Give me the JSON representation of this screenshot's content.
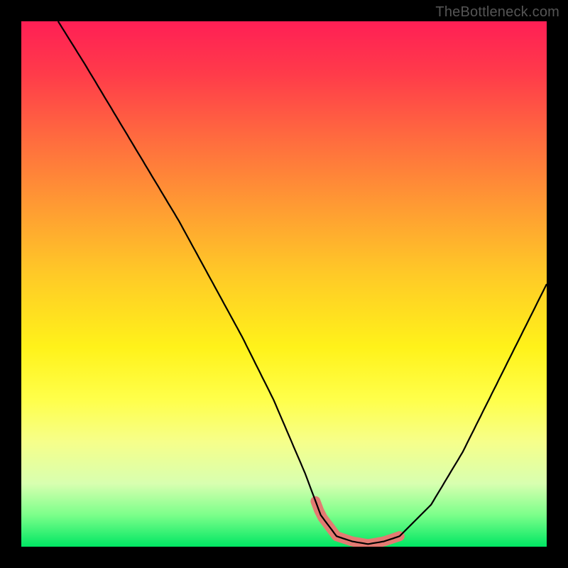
{
  "watermark": "TheBottleneck.com",
  "chart_data": {
    "type": "line",
    "title": "",
    "xlabel": "",
    "ylabel": "",
    "xlim": [
      0,
      100
    ],
    "ylim": [
      0,
      100
    ],
    "grid": false,
    "legend": false,
    "series": [
      {
        "name": "bottleneck-curve",
        "x": [
          7,
          12,
          18,
          24,
          30,
          36,
          42,
          48,
          54,
          57,
          60,
          63,
          66,
          69,
          72,
          78,
          84,
          90,
          96,
          100
        ],
        "y": [
          100,
          92,
          82,
          72,
          62,
          51,
          40,
          28,
          14,
          6,
          2,
          1,
          0.5,
          1,
          2,
          8,
          18,
          30,
          42,
          50
        ]
      }
    ],
    "highlight": {
      "name": "optimal-zone",
      "x_range": [
        56,
        72
      ],
      "y_approx": 1,
      "color": "#e37a72"
    },
    "background_gradient": {
      "direction": "vertical",
      "stops": [
        {
          "pos": 0,
          "color": "#ff1f55"
        },
        {
          "pos": 22,
          "color": "#ff6a3f"
        },
        {
          "pos": 48,
          "color": "#ffc927"
        },
        {
          "pos": 72,
          "color": "#ffff4a"
        },
        {
          "pos": 94,
          "color": "#7bff8a"
        },
        {
          "pos": 100,
          "color": "#00e663"
        }
      ]
    }
  }
}
